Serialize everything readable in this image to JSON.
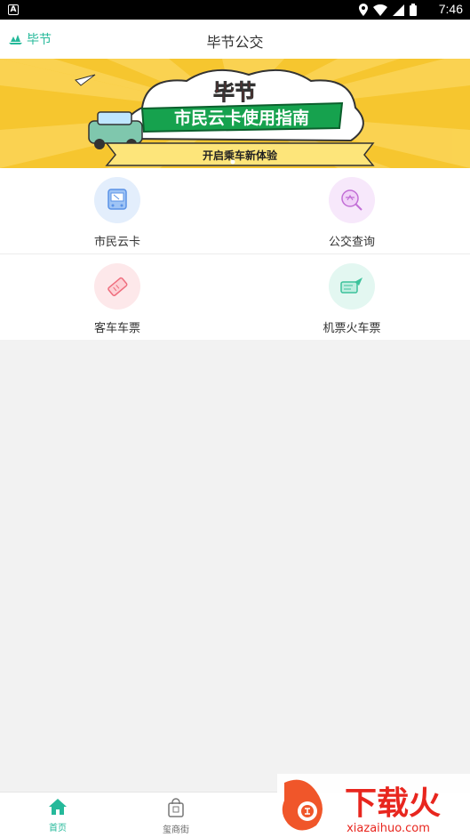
{
  "status_bar": {
    "time": "7:46",
    "notification_icon": "A"
  },
  "header": {
    "location": "毕节",
    "title": "毕节公交"
  },
  "banner": {
    "headline": "毕节",
    "subtitle": "市民云卡使用指南",
    "tagline": "开启乘车新体验"
  },
  "services": [
    {
      "label": "市民云卡",
      "icon": "bus-card-icon",
      "color": "#e3eefc"
    },
    {
      "label": "公交查询",
      "icon": "bus-search-icon",
      "color": "#f7e8fb"
    },
    {
      "label": "客车车票",
      "icon": "coach-ticket-icon",
      "color": "#fde8ea"
    },
    {
      "label": "机票火车票",
      "icon": "plane-train-icon",
      "color": "#e3f7f1"
    }
  ],
  "tabs": [
    {
      "label": "首页",
      "icon": "home-icon",
      "active": true
    },
    {
      "label": "玺商街",
      "icon": "shop-bag-icon",
      "active": false
    }
  ],
  "watermark": {
    "text": "下载火",
    "url": "xiazaihuo.com"
  },
  "colors": {
    "accent": "#25b99a",
    "banner": "#f6c62f"
  }
}
